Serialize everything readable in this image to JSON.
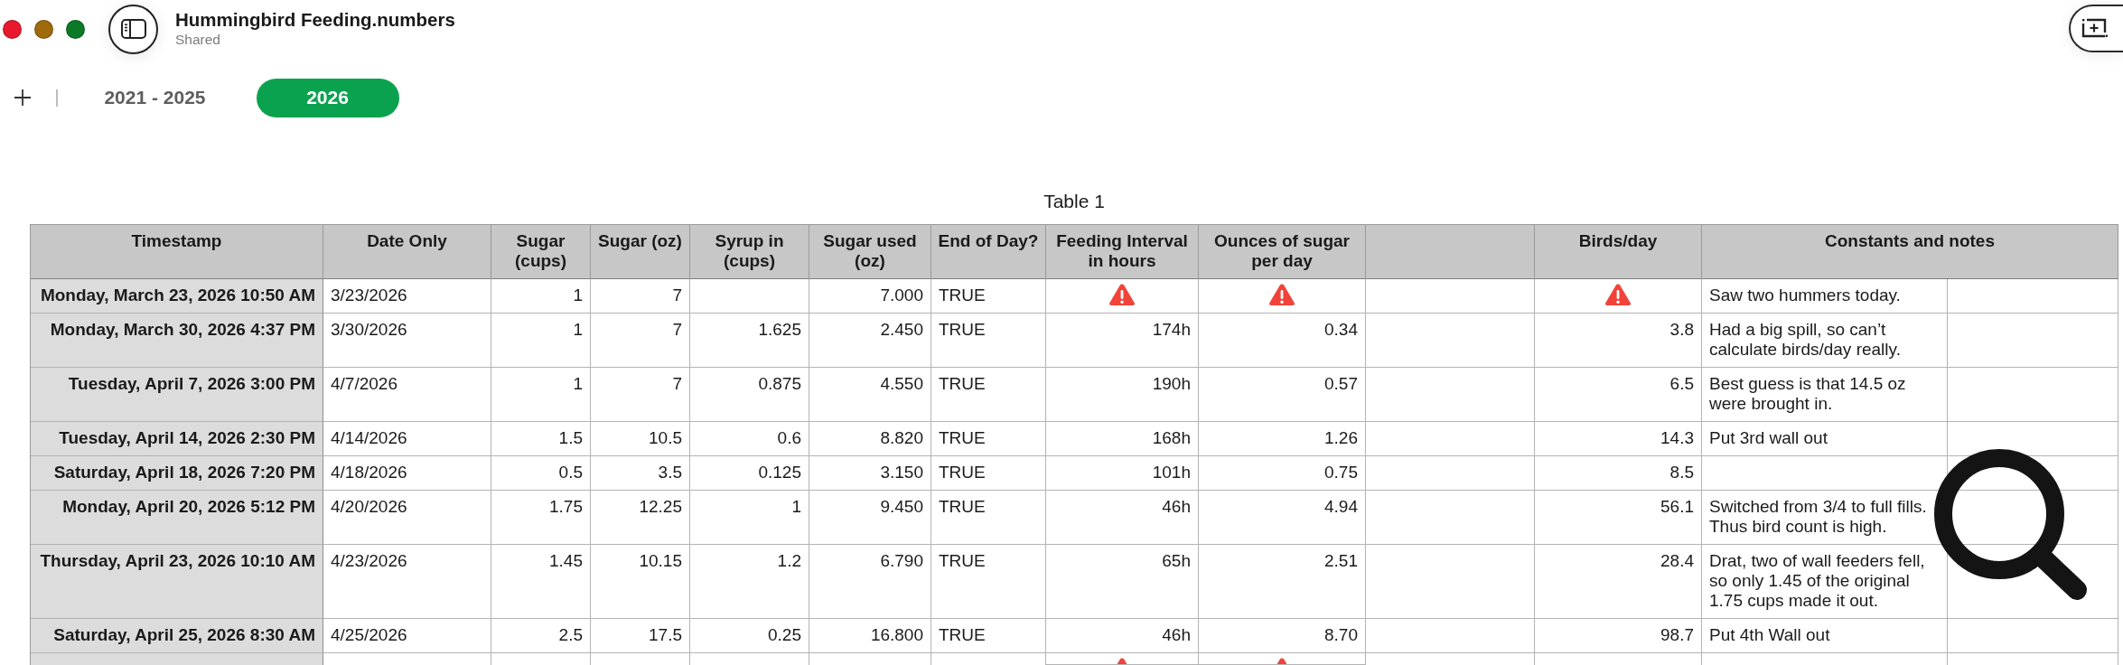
{
  "window": {
    "title": "Hummingbird Feeding.numbers",
    "subtitle": "Shared"
  },
  "tabs": [
    {
      "label": "2021 - 2025",
      "selected": false
    },
    {
      "label": "2026",
      "selected": true
    }
  ],
  "table": {
    "title": "Table 1",
    "columns": [
      "Timestamp",
      "Date Only",
      "Sugar (cups)",
      "Sugar (oz)",
      "Syrup in (cups)",
      "Sugar used (oz)",
      "End of Day?",
      "Feeding Interval in hours",
      "Ounces of sugar per day",
      "Birds/day",
      "Constants and notes"
    ],
    "rows": [
      {
        "timestamp": "Monday, March 23, 2026 10:50 AM",
        "date_only": "3/23/2026",
        "sugar_cups": "1",
        "sugar_oz": "7",
        "sugar_used_oz": "7.000",
        "end_of_day": "TRUE",
        "feeding_interval_error": true,
        "ounces_per_day_error": true,
        "birds_per_day_error": true,
        "notes": "Saw two hummers today."
      },
      {
        "timestamp": "Monday, March 30, 2026 4:37 PM",
        "date_only": "3/30/2026",
        "sugar_cups": "1",
        "sugar_oz": "7",
        "syrup_in_cups": "1.625",
        "sugar_used_oz": "2.450",
        "end_of_day": "TRUE",
        "feeding_interval": "174h",
        "feeding_interval_error": false,
        "ounces_per_day": "0.34",
        "ounces_per_day_error": false,
        "birds_per_day": "3.8",
        "birds_per_day_error": false,
        "notes": "Had a big spill, so can’t calculate birds/day really."
      },
      {
        "timestamp": "Tuesday, April 7, 2026 3:00 PM",
        "date_only": "4/7/2026",
        "sugar_cups": "1",
        "sugar_oz": "7",
        "syrup_in_cups": "0.875",
        "sugar_used_oz": "4.550",
        "end_of_day": "TRUE",
        "feeding_interval": "190h",
        "feeding_interval_error": false,
        "ounces_per_day": "0.57",
        "ounces_per_day_error": false,
        "birds_per_day": "6.5",
        "birds_per_day_error": false,
        "notes": "Best guess is that 14.5 oz were brought in."
      },
      {
        "timestamp": "Tuesday, April 14, 2026 2:30 PM",
        "date_only": "4/14/2026",
        "sugar_cups": "1.5",
        "sugar_oz": "10.5",
        "syrup_in_cups": "0.6",
        "sugar_used_oz": "8.820",
        "end_of_day": "TRUE",
        "feeding_interval": "168h",
        "feeding_interval_error": false,
        "ounces_per_day": "1.26",
        "ounces_per_day_error": false,
        "birds_per_day": "14.3",
        "birds_per_day_error": false,
        "notes": "Put 3rd wall out"
      },
      {
        "timestamp": "Saturday, April 18, 2026 7:20 PM",
        "date_only": "4/18/2026",
        "sugar_cups": "0.5",
        "sugar_oz": "3.5",
        "syrup_in_cups": "0.125",
        "sugar_used_oz": "3.150",
        "end_of_day": "TRUE",
        "feeding_interval": "101h",
        "feeding_interval_error": false,
        "ounces_per_day": "0.75",
        "ounces_per_day_error": false,
        "birds_per_day": "8.5",
        "birds_per_day_error": false
      },
      {
        "timestamp": "Monday, April 20, 2026 5:12 PM",
        "date_only": "4/20/2026",
        "sugar_cups": "1.75",
        "sugar_oz": "12.25",
        "syrup_in_cups": "1",
        "sugar_used_oz": "9.450",
        "end_of_day": "TRUE",
        "feeding_interval": "46h",
        "feeding_interval_error": false,
        "ounces_per_day": "4.94",
        "ounces_per_day_error": false,
        "birds_per_day": "56.1",
        "birds_per_day_error": false,
        "notes": "Switched from 3/4 to full fills. Thus bird count is high."
      },
      {
        "timestamp": "Thursday, April 23, 2026 10:10 AM",
        "date_only": "4/23/2026",
        "sugar_cups": "1.45",
        "sugar_oz": "10.15",
        "syrup_in_cups": "1.2",
        "sugar_used_oz": "6.790",
        "end_of_day": "TRUE",
        "feeding_interval": "65h",
        "feeding_interval_error": false,
        "ounces_per_day": "2.51",
        "ounces_per_day_error": false,
        "birds_per_day": "28.4",
        "birds_per_day_error": false,
        "notes": "Drat, two of wall feeders fell, so only 1.45 of the original 1.75 cups made it out."
      },
      {
        "timestamp": "Saturday, April 25, 2026 8:30 AM",
        "date_only": "4/25/2026",
        "sugar_cups": "2.5",
        "sugar_oz": "17.5",
        "syrup_in_cups": "0.25",
        "sugar_used_oz": "16.800",
        "end_of_day": "TRUE",
        "feeding_interval": "46h",
        "feeding_interval_error": false,
        "ounces_per_day": "8.70",
        "ounces_per_day_error": false,
        "birds_per_day": "98.7",
        "birds_per_day_error": false,
        "notes": "Put 4th Wall out"
      },
      {
        "feeding_interval_error": true,
        "ounces_per_day_error": true,
        "birds_per_day_error": false
      }
    ]
  }
}
